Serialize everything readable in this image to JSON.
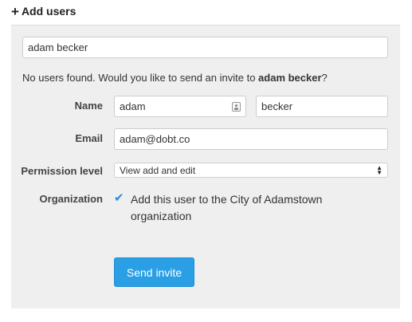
{
  "header": {
    "icon": "plus-icon",
    "title": "Add users"
  },
  "search": {
    "value": "adam becker"
  },
  "message": {
    "prefix": "No users found. Would you like to send an invite to ",
    "name": "adam becker",
    "suffix": "?"
  },
  "form": {
    "name_label": "Name",
    "first_name": "adam",
    "last_name": "becker",
    "email_label": "Email",
    "email": "adam@dobt.co",
    "permission_label": "Permission level",
    "permission_value": "View add and edit",
    "organization_label": "Organization",
    "organization_checked": true,
    "organization_text": "Add this user to the City of Adamstown organization",
    "send_label": "Send invite"
  },
  "colors": {
    "accent": "#2a9fe6",
    "panel": "#efefef"
  }
}
